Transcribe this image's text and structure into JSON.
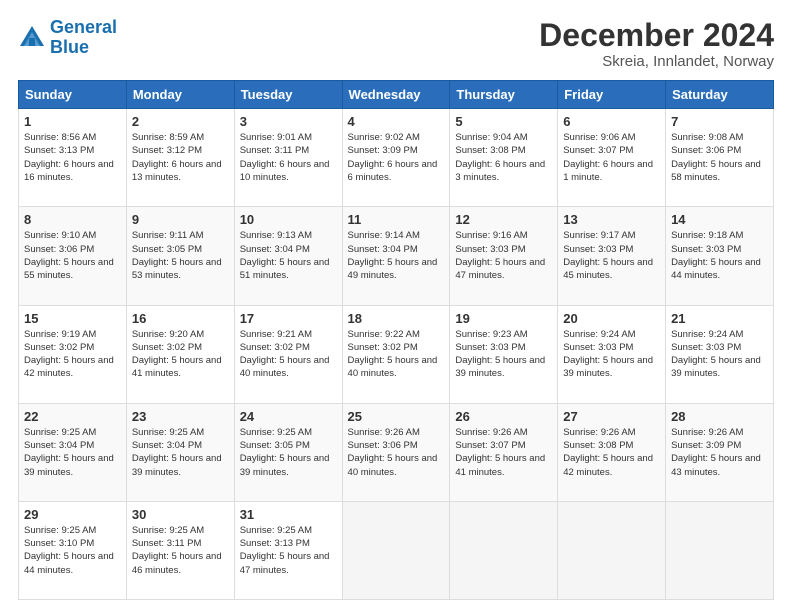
{
  "logo": {
    "line1": "General",
    "line2": "Blue"
  },
  "header": {
    "title": "December 2024",
    "subtitle": "Skreia, Innlandet, Norway"
  },
  "weekdays": [
    "Sunday",
    "Monday",
    "Tuesday",
    "Wednesday",
    "Thursday",
    "Friday",
    "Saturday"
  ],
  "weeks": [
    [
      {
        "day": "1",
        "sunrise": "Sunrise: 8:56 AM",
        "sunset": "Sunset: 3:13 PM",
        "daylight": "Daylight: 6 hours and 16 minutes."
      },
      {
        "day": "2",
        "sunrise": "Sunrise: 8:59 AM",
        "sunset": "Sunset: 3:12 PM",
        "daylight": "Daylight: 6 hours and 13 minutes."
      },
      {
        "day": "3",
        "sunrise": "Sunrise: 9:01 AM",
        "sunset": "Sunset: 3:11 PM",
        "daylight": "Daylight: 6 hours and 10 minutes."
      },
      {
        "day": "4",
        "sunrise": "Sunrise: 9:02 AM",
        "sunset": "Sunset: 3:09 PM",
        "daylight": "Daylight: 6 hours and 6 minutes."
      },
      {
        "day": "5",
        "sunrise": "Sunrise: 9:04 AM",
        "sunset": "Sunset: 3:08 PM",
        "daylight": "Daylight: 6 hours and 3 minutes."
      },
      {
        "day": "6",
        "sunrise": "Sunrise: 9:06 AM",
        "sunset": "Sunset: 3:07 PM",
        "daylight": "Daylight: 6 hours and 1 minute."
      },
      {
        "day": "7",
        "sunrise": "Sunrise: 9:08 AM",
        "sunset": "Sunset: 3:06 PM",
        "daylight": "Daylight: 5 hours and 58 minutes."
      }
    ],
    [
      {
        "day": "8",
        "sunrise": "Sunrise: 9:10 AM",
        "sunset": "Sunset: 3:06 PM",
        "daylight": "Daylight: 5 hours and 55 minutes."
      },
      {
        "day": "9",
        "sunrise": "Sunrise: 9:11 AM",
        "sunset": "Sunset: 3:05 PM",
        "daylight": "Daylight: 5 hours and 53 minutes."
      },
      {
        "day": "10",
        "sunrise": "Sunrise: 9:13 AM",
        "sunset": "Sunset: 3:04 PM",
        "daylight": "Daylight: 5 hours and 51 minutes."
      },
      {
        "day": "11",
        "sunrise": "Sunrise: 9:14 AM",
        "sunset": "Sunset: 3:04 PM",
        "daylight": "Daylight: 5 hours and 49 minutes."
      },
      {
        "day": "12",
        "sunrise": "Sunrise: 9:16 AM",
        "sunset": "Sunset: 3:03 PM",
        "daylight": "Daylight: 5 hours and 47 minutes."
      },
      {
        "day": "13",
        "sunrise": "Sunrise: 9:17 AM",
        "sunset": "Sunset: 3:03 PM",
        "daylight": "Daylight: 5 hours and 45 minutes."
      },
      {
        "day": "14",
        "sunrise": "Sunrise: 9:18 AM",
        "sunset": "Sunset: 3:03 PM",
        "daylight": "Daylight: 5 hours and 44 minutes."
      }
    ],
    [
      {
        "day": "15",
        "sunrise": "Sunrise: 9:19 AM",
        "sunset": "Sunset: 3:02 PM",
        "daylight": "Daylight: 5 hours and 42 minutes."
      },
      {
        "day": "16",
        "sunrise": "Sunrise: 9:20 AM",
        "sunset": "Sunset: 3:02 PM",
        "daylight": "Daylight: 5 hours and 41 minutes."
      },
      {
        "day": "17",
        "sunrise": "Sunrise: 9:21 AM",
        "sunset": "Sunset: 3:02 PM",
        "daylight": "Daylight: 5 hours and 40 minutes."
      },
      {
        "day": "18",
        "sunrise": "Sunrise: 9:22 AM",
        "sunset": "Sunset: 3:02 PM",
        "daylight": "Daylight: 5 hours and 40 minutes."
      },
      {
        "day": "19",
        "sunrise": "Sunrise: 9:23 AM",
        "sunset": "Sunset: 3:03 PM",
        "daylight": "Daylight: 5 hours and 39 minutes."
      },
      {
        "day": "20",
        "sunrise": "Sunrise: 9:24 AM",
        "sunset": "Sunset: 3:03 PM",
        "daylight": "Daylight: 5 hours and 39 minutes."
      },
      {
        "day": "21",
        "sunrise": "Sunrise: 9:24 AM",
        "sunset": "Sunset: 3:03 PM",
        "daylight": "Daylight: 5 hours and 39 minutes."
      }
    ],
    [
      {
        "day": "22",
        "sunrise": "Sunrise: 9:25 AM",
        "sunset": "Sunset: 3:04 PM",
        "daylight": "Daylight: 5 hours and 39 minutes."
      },
      {
        "day": "23",
        "sunrise": "Sunrise: 9:25 AM",
        "sunset": "Sunset: 3:04 PM",
        "daylight": "Daylight: 5 hours and 39 minutes."
      },
      {
        "day": "24",
        "sunrise": "Sunrise: 9:25 AM",
        "sunset": "Sunset: 3:05 PM",
        "daylight": "Daylight: 5 hours and 39 minutes."
      },
      {
        "day": "25",
        "sunrise": "Sunrise: 9:26 AM",
        "sunset": "Sunset: 3:06 PM",
        "daylight": "Daylight: 5 hours and 40 minutes."
      },
      {
        "day": "26",
        "sunrise": "Sunrise: 9:26 AM",
        "sunset": "Sunset: 3:07 PM",
        "daylight": "Daylight: 5 hours and 41 minutes."
      },
      {
        "day": "27",
        "sunrise": "Sunrise: 9:26 AM",
        "sunset": "Sunset: 3:08 PM",
        "daylight": "Daylight: 5 hours and 42 minutes."
      },
      {
        "day": "28",
        "sunrise": "Sunrise: 9:26 AM",
        "sunset": "Sunset: 3:09 PM",
        "daylight": "Daylight: 5 hours and 43 minutes."
      }
    ],
    [
      {
        "day": "29",
        "sunrise": "Sunrise: 9:25 AM",
        "sunset": "Sunset: 3:10 PM",
        "daylight": "Daylight: 5 hours and 44 minutes."
      },
      {
        "day": "30",
        "sunrise": "Sunrise: 9:25 AM",
        "sunset": "Sunset: 3:11 PM",
        "daylight": "Daylight: 5 hours and 46 minutes."
      },
      {
        "day": "31",
        "sunrise": "Sunrise: 9:25 AM",
        "sunset": "Sunset: 3:13 PM",
        "daylight": "Daylight: 5 hours and 47 minutes."
      },
      null,
      null,
      null,
      null
    ]
  ]
}
